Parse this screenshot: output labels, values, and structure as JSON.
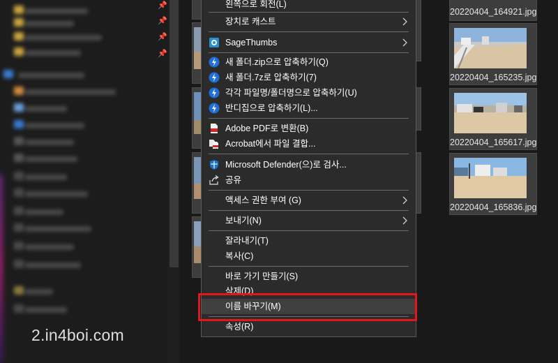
{
  "context_menu": {
    "items": [
      {
        "label": "왼쪽으로 회전(L)",
        "icon": "none"
      },
      {
        "label": "장치로 캐스트",
        "icon": "none",
        "submenu": true
      },
      {
        "label": "SageThumbs",
        "icon": "sagethumbs-icon",
        "submenu": true
      },
      {
        "label": "새 폴더.zip으로 압축하기(Q)",
        "icon": "bandizip-icon"
      },
      {
        "label": "새 폴더.7z로 압축하기(7)",
        "icon": "bandizip-icon"
      },
      {
        "label": "각각 파일명/폴더명으로 압축하기(U)",
        "icon": "bandizip-icon"
      },
      {
        "label": "반디집으로 압축하기(L)...",
        "icon": "bandizip-icon"
      },
      {
        "label": "Adobe PDF로 변환(B)",
        "icon": "adobe-pdf-icon"
      },
      {
        "label": "Acrobat에서 파일 결합...",
        "icon": "acrobat-combine-icon"
      },
      {
        "label": "Microsoft Defender(으)로 검사...",
        "icon": "defender-shield-icon"
      },
      {
        "label": "공유",
        "icon": "share-icon"
      },
      {
        "label": "액세스 권한 부여 (G)",
        "icon": "none",
        "submenu": true
      },
      {
        "label": "보내기(N)",
        "icon": "none",
        "submenu": true
      },
      {
        "label": "잘라내기(T)",
        "icon": "none"
      },
      {
        "label": "복사(C)",
        "icon": "none"
      },
      {
        "label": "바로 가기 만들기(S)",
        "icon": "none"
      },
      {
        "label": "삭제(D)",
        "icon": "none"
      },
      {
        "label": "이름 바꾸기(M)",
        "icon": "none",
        "highlighted": true
      },
      {
        "label": "속성(R)",
        "icon": "none"
      }
    ]
  },
  "thumbnails": [
    {
      "filename": "20220404_164921.jpg"
    },
    {
      "filename": "20220404_165235.jpg"
    },
    {
      "filename": "20220404_165617.jpg"
    },
    {
      "filename": "20220404_165836.jpg"
    }
  ],
  "watermark": "2.in4boi.com",
  "colors": {
    "menu_bg": "#2b2b2b",
    "menu_hover": "#404040",
    "highlight_border": "#e0181b",
    "bandizip_blue": "#1e6fd8",
    "defender_blue": "#1a73c8"
  }
}
